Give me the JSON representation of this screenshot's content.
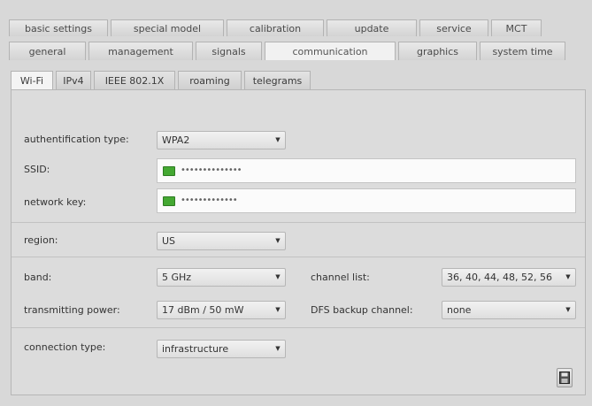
{
  "tabs_top": [
    {
      "label": "basic settings"
    },
    {
      "label": "special model"
    },
    {
      "label": "calibration"
    },
    {
      "label": "update"
    },
    {
      "label": "service"
    },
    {
      "label": "MCT"
    }
  ],
  "tabs_mid": [
    {
      "label": "general"
    },
    {
      "label": "management"
    },
    {
      "label": "signals"
    },
    {
      "label": "communication"
    },
    {
      "label": "graphics"
    },
    {
      "label": "system time"
    }
  ],
  "subtabs": [
    {
      "label": "Wi-Fi"
    },
    {
      "label": "IPv4"
    },
    {
      "label": "IEEE 802.1X"
    },
    {
      "label": "roaming"
    },
    {
      "label": "telegrams"
    }
  ],
  "form": {
    "auth_label": "authentification type:",
    "auth_value": "WPA2",
    "ssid_label": "SSID:",
    "ssid_value": "••••••••••••••",
    "netkey_label": "network key:",
    "netkey_value": "•••••••••••••",
    "region_label": "region:",
    "region_value": "US",
    "band_label": "band:",
    "band_value": "5 GHz",
    "channel_list_label": "channel list:",
    "channel_list_value": "36, 40, 44, 48, 52, 56",
    "tx_power_label": "transmitting power:",
    "tx_power_value": "17 dBm / 50 mW",
    "dfs_label": "DFS backup channel:",
    "dfs_value": "none",
    "conn_type_label": "connection type:",
    "conn_type_value": "infrastructure"
  },
  "colors": {
    "status_led": "#44a832",
    "panel_bg": "#dcdcdc"
  },
  "icons": {
    "dropdown": "triangle-down",
    "save": "floppy-disk"
  }
}
